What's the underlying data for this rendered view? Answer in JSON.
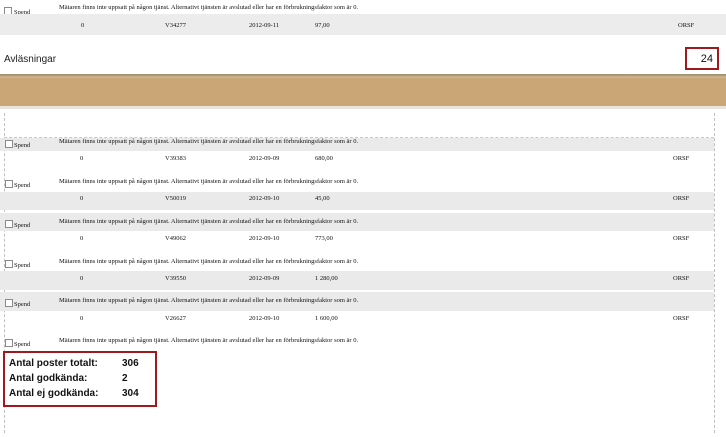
{
  "top_record": {
    "checkbox_label": "Spend",
    "message": "Mätaren finns inte uppsatt på någon tjänst. Alternativt tjänsten är avslutad eller har en förbrukningsfaktor som är 0.",
    "count": "0",
    "meter": "V34277",
    "date": "2012-09-11",
    "value": "97,00",
    "code": "ORSF"
  },
  "section": {
    "title": "Avläsningar",
    "count": "24"
  },
  "records": [
    {
      "checkbox_label": "Spend",
      "message": "Mätaren finns inte uppsatt på någon tjänst. Alternativt tjänsten är avslutad eller har en förbrukningsfaktor som är 0.",
      "count": "0",
      "meter": "V39383",
      "date": "2012-09-09",
      "value": "680,00",
      "code": "ORSF"
    },
    {
      "checkbox_label": "Spend",
      "message": "Mätaren finns inte uppsatt på någon tjänst. Alternativt tjänsten är avslutad eller har en förbrukningsfaktor som är 0.",
      "count": "0",
      "meter": "V50019",
      "date": "2012-09-10",
      "value": "45,00",
      "code": "ORSF"
    },
    {
      "checkbox_label": "Spend",
      "message": "Mätaren finns inte uppsatt på någon tjänst. Alternativt tjänsten är avslutad eller har en förbrukningsfaktor som är 0.",
      "count": "0",
      "meter": "V49062",
      "date": "2012-09-10",
      "value": "773,00",
      "code": "ORSF"
    },
    {
      "checkbox_label": "Spend",
      "message": "Mätaren finns inte uppsatt på någon tjänst. Alternativt tjänsten är avslutad eller har en förbrukningsfaktor som är 0.",
      "count": "0",
      "meter": "V39550",
      "date": "2012-09-09",
      "value": "1 280,00",
      "code": "ORSF"
    },
    {
      "checkbox_label": "Spend",
      "message": "Mätaren finns inte uppsatt på någon tjänst. Alternativt tjänsten är avslutad eller har en förbrukningsfaktor som är 0.",
      "count": "0",
      "meter": "V26627",
      "date": "2012-09-10",
      "value": "1 600,00",
      "code": "ORSF"
    }
  ],
  "last_record": {
    "checkbox_label": "Spend",
    "message": "Mätaren finns inte uppsatt på någon tjänst. Alternativt tjänsten är avslutad eller har en förbrukningsfaktor som är 0."
  },
  "summary": {
    "total_label": "Antal poster totalt:",
    "total_value": "306",
    "approved_label": "Antal godkända:",
    "approved_value": "2",
    "rejected_label": "Antal ej godkända:",
    "rejected_value": "304"
  },
  "colors": {
    "highlight_border": "#a0191c",
    "tan_band": "#caa676",
    "row_band": "#ececec"
  }
}
